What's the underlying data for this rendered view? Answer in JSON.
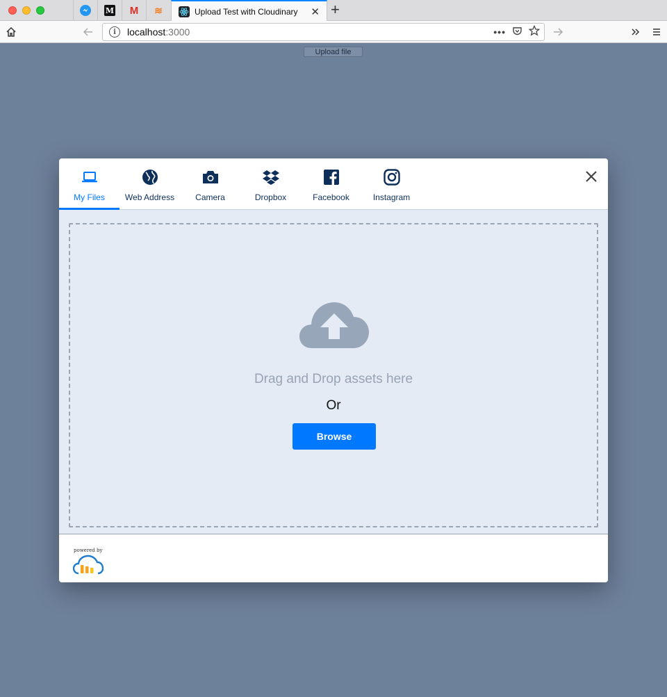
{
  "browser": {
    "active_tab_title": "Upload Test with Cloudinary",
    "url_host": "localhost",
    "url_port": ":3000",
    "pinned_tabs": [
      "messenger-icon",
      "medium-icon",
      "gmail-icon",
      "stackoverflow-icon"
    ]
  },
  "page": {
    "upload_button_label": "Upload file"
  },
  "widget": {
    "sources": [
      {
        "label": "My Files",
        "icon": "laptop-icon",
        "active": true
      },
      {
        "label": "Web Address",
        "icon": "globe-icon",
        "active": false
      },
      {
        "label": "Camera",
        "icon": "camera-icon",
        "active": false
      },
      {
        "label": "Dropbox",
        "icon": "dropbox-icon",
        "active": false
      },
      {
        "label": "Facebook",
        "icon": "facebook-icon",
        "active": false
      },
      {
        "label": "Instagram",
        "icon": "instagram-icon",
        "active": false
      }
    ],
    "drop_text": "Drag and Drop assets here",
    "or_text": "Or",
    "browse_label": "Browse",
    "powered_by": "powered by",
    "colors": {
      "accent": "#0078ff",
      "navy": "#0e2f5a",
      "drop_bg": "#e4ebf4",
      "cloud": "#98a6b9"
    }
  }
}
